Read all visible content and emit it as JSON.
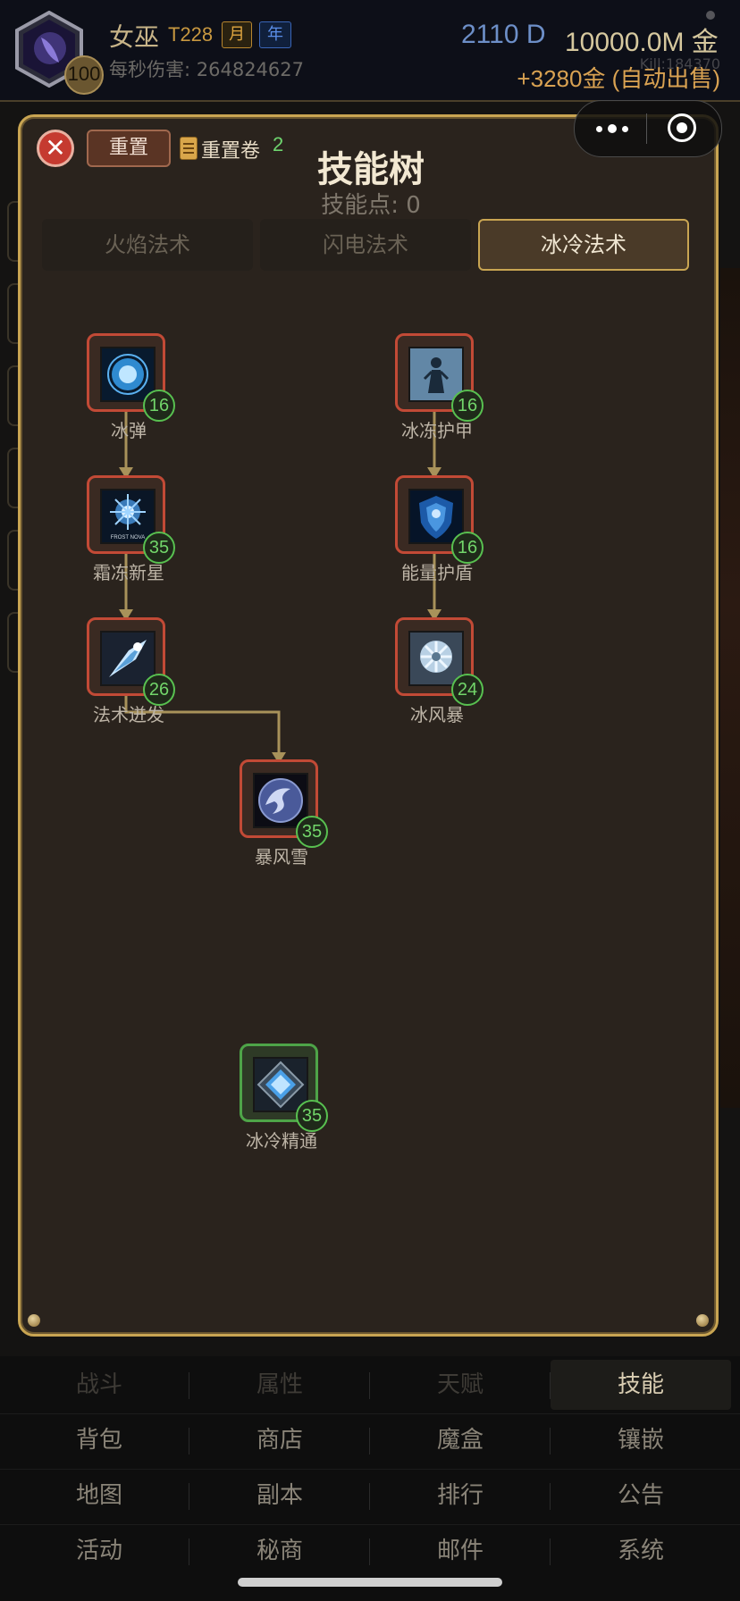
{
  "header": {
    "name": "女巫",
    "tier": "T228",
    "month_badge": "月",
    "year_badge": "年",
    "level": "100",
    "dps_label": "每秒伤害: 264824627",
    "currency_d": "2110 D",
    "gold": "10000.0M 金",
    "gold_income": "+3280金 (自动出售)",
    "kills": "Kill:184370"
  },
  "panel": {
    "title": "技能树",
    "skill_points": "技能点: 0",
    "close_symbol": "✕",
    "reset_label": "重置",
    "reset_scroll_label": "重置卷",
    "reset_scroll_count": "2"
  },
  "tabs": [
    {
      "label": "火焰法术",
      "active": false
    },
    {
      "label": "闪电法术",
      "active": false
    },
    {
      "label": "冰冷法术",
      "active": true
    }
  ],
  "skills": [
    {
      "name": "冰弹",
      "level": "16",
      "icon": "ice-bolt-icon"
    },
    {
      "name": "霜冻新星",
      "level": "35",
      "icon": "frost-nova-icon",
      "icon_caption": "FROST NOVA"
    },
    {
      "name": "法术迸发",
      "level": "26",
      "icon": "spell-burst-icon"
    },
    {
      "name": "冰冻护甲",
      "level": "16",
      "icon": "frozen-armor-icon"
    },
    {
      "name": "能量护盾",
      "level": "16",
      "icon": "energy-shield-icon"
    },
    {
      "name": "冰风暴",
      "level": "24",
      "icon": "ice-storm-icon"
    },
    {
      "name": "暴风雪",
      "level": "35",
      "icon": "blizzard-icon"
    },
    {
      "name": "冰冷精通",
      "level": "35",
      "icon": "cold-mastery-icon"
    }
  ],
  "bottom_nav": [
    [
      {
        "label": "战斗"
      },
      {
        "label": "属性"
      },
      {
        "label": "天赋"
      },
      {
        "label": "技能",
        "active": true
      }
    ],
    [
      {
        "label": "背包"
      },
      {
        "label": "商店"
      },
      {
        "label": "魔盒"
      },
      {
        "label": "镶嵌"
      }
    ],
    [
      {
        "label": "地图"
      },
      {
        "label": "副本"
      },
      {
        "label": "排行"
      },
      {
        "label": "公告"
      }
    ],
    [
      {
        "label": "活动"
      },
      {
        "label": "秘商"
      },
      {
        "label": "邮件"
      },
      {
        "label": "系统"
      }
    ]
  ],
  "colors": {
    "panel_border": "#c9a552",
    "node_border_active": "#c24a36",
    "node_border_mastery": "#4ea448",
    "level_ring": "#58c050",
    "connector": "#a8925a"
  }
}
